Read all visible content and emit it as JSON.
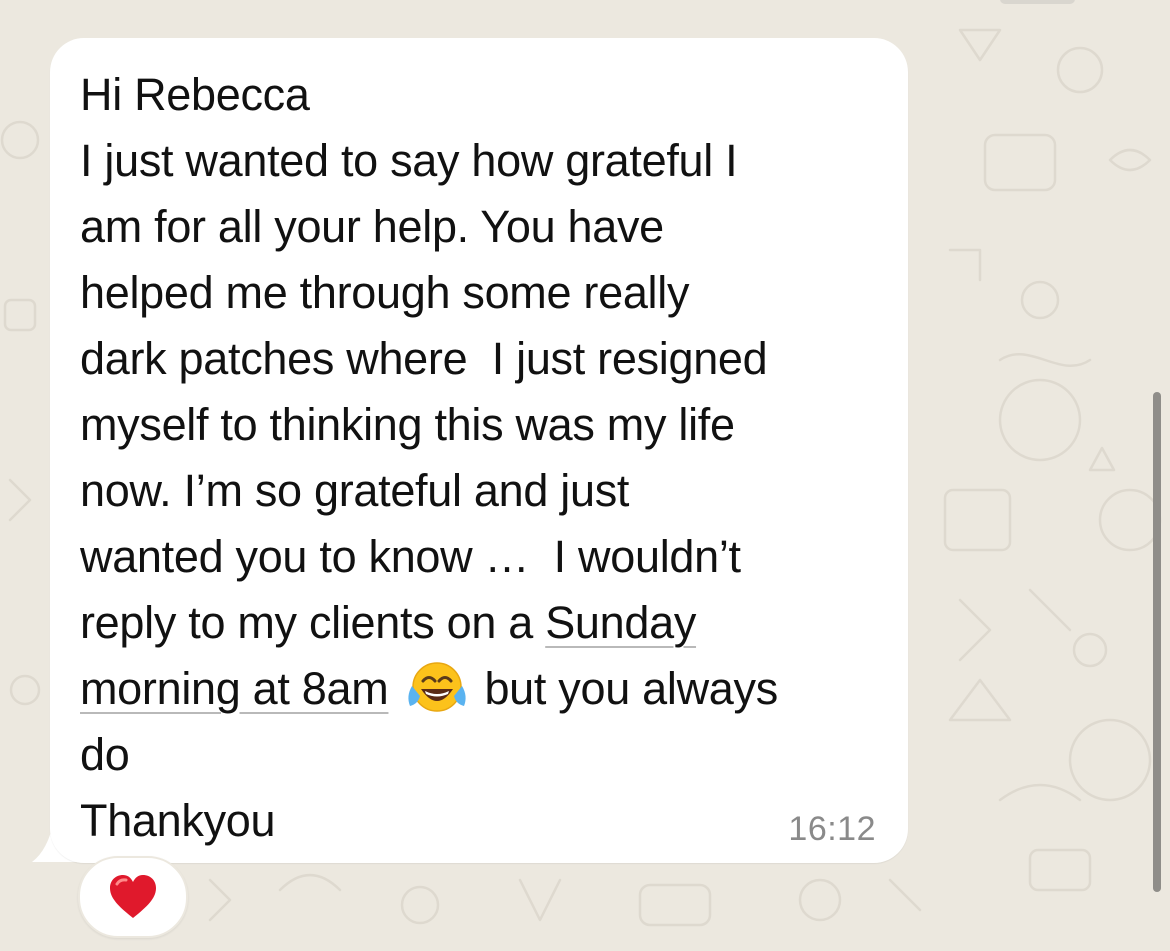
{
  "chat": {
    "message": {
      "lines": {
        "l1": "Hi Rebecca",
        "l2": "I just wanted to say how grateful I",
        "l3": "am for all your help. You have",
        "l4": "helped me through some really",
        "l5": "dark patches where  I just resigned",
        "l6": "myself to thinking this was my life",
        "l7": "now. I’m so grateful and just",
        "l8": "wanted you to know …  I wouldn’t",
        "l9_prefix": "reply to my clients on a ",
        "l9_link": "Sunday",
        "l10_link": "morning at 8am",
        "l10_suffix": "but you always",
        "l11": "do",
        "l12": "Thankyou"
      },
      "emoji": "tears-of-joy-emoji",
      "timestamp": "16:12"
    },
    "reaction": {
      "icon": "red-heart-icon"
    }
  },
  "colors": {
    "background": "#ece8df",
    "bubble": "#ffffff",
    "text": "#111111",
    "timestamp": "#8a8a8a",
    "heart": "#e0192c"
  }
}
